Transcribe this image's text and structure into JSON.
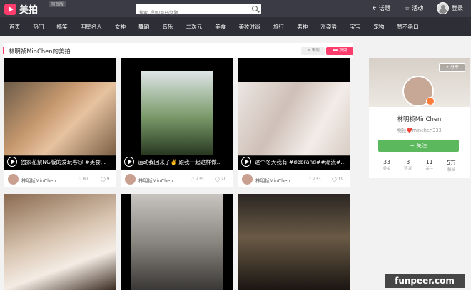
{
  "topbar": {
    "logo_text": "美拍",
    "logo_tag": "网页版",
    "search_placeholder": "搜索: 视频/用户/话题",
    "topics_label": "话题",
    "activity_label": "活动",
    "login_label": "登录"
  },
  "categories": [
    "首页",
    "热门",
    "搞笑",
    "明星名人",
    "女神",
    "舞蹈",
    "音乐",
    "二次元",
    "美食",
    "美妆时尚",
    "旅行",
    "男神",
    "涨姿势",
    "宝宝",
    "宠物",
    "赞不绝口"
  ],
  "main": {
    "title": "林明祯MinChen的美拍",
    "view_single": "单列",
    "view_double": "双列"
  },
  "videos": [
    {
      "caption": "独家花絮NG版的爱玩客😏 #美食...",
      "author": "林明祯MinChen",
      "likes": "87",
      "comments": "9"
    },
    {
      "caption": "运动我回来了✌️ 跟我一起这样做...",
      "author": "林明祯MinChen",
      "likes": "235",
      "comments": "20"
    },
    {
      "caption": "这个冬天我有 #debrand##潮流#...",
      "author": "林明祯MinChen",
      "likes": "233",
      "comments": "19"
    }
  ],
  "profile": {
    "share_label": "分享",
    "name": "林明祯MinChen",
    "subtitle": "明祯❤️minchen333",
    "follow_label": "+ 关注",
    "stats": [
      {
        "num": "33",
        "label": "美拍"
      },
      {
        "num": "3",
        "label": "转发"
      },
      {
        "num": "11",
        "label": "关注"
      },
      {
        "num": "5万",
        "label": "粉丝"
      }
    ]
  },
  "watermark": "funpeer.com",
  "colors": {
    "accent": "#ff3d6d",
    "follow": "#5cb85c",
    "topbar": "#3b3b46"
  }
}
